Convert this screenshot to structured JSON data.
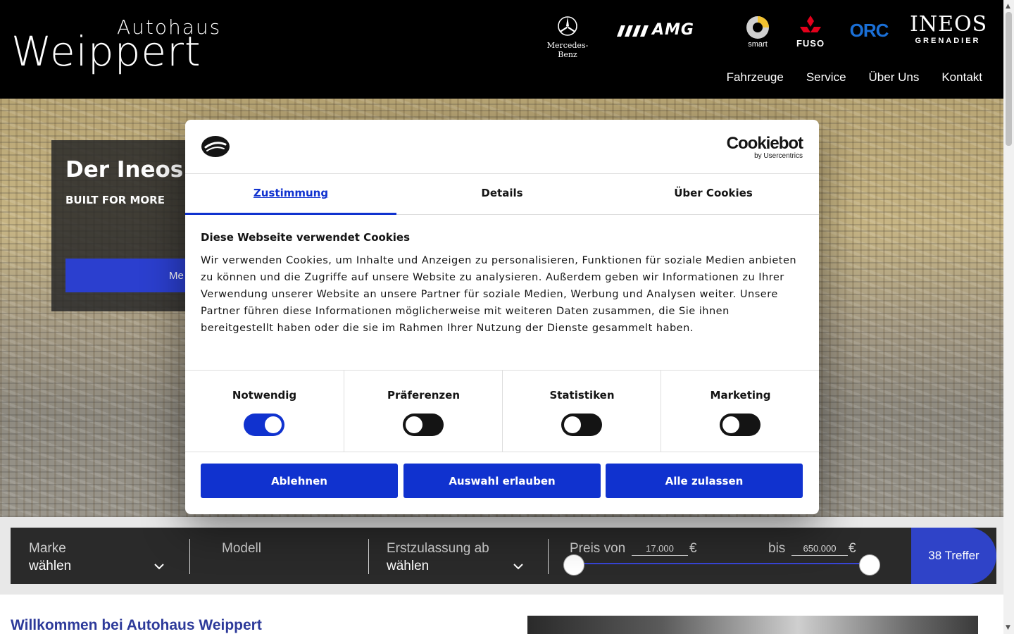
{
  "header": {
    "logo_top": "Autohaus",
    "logo_bottom": "Weippert",
    "brands": [
      "Mercedes-Benz",
      "AMG",
      "smart",
      "FUSO",
      "ORC",
      "INEOS",
      "GRENADIER"
    ],
    "nav": [
      "Fahrzeuge",
      "Service",
      "Über Uns",
      "Kontakt"
    ]
  },
  "hero": {
    "title": "Der Ineos G",
    "subtitle": "BUILT FOR MORE",
    "button": "Me"
  },
  "search": {
    "marke_label": "Marke",
    "marke_value": "wählen",
    "modell_label": "Modell",
    "ez_label": "Erstzulassung ab",
    "ez_value": "wählen",
    "preis_von_label": "Preis von",
    "preis_von": "17.000",
    "bis_label": "bis",
    "preis_bis": "650.000",
    "currency": "€",
    "treffer": "38 Treffer"
  },
  "welcome": "Willkommen bei Autohaus Weippert",
  "cookie": {
    "brand": "Cookiebot",
    "brand_by": "by Usercentrics",
    "tabs": [
      "Zustimmung",
      "Details",
      "Über Cookies"
    ],
    "active_tab": "Zustimmung",
    "heading": "Diese Webseite verwendet Cookies",
    "text": "Wir verwenden Cookies, um Inhalte und Anzeigen zu personalisieren, Funktionen für soziale Medien anbieten zu können und die Zugriffe auf unsere Website zu analysieren. Außerdem geben wir Informationen zu Ihrer Verwendung unserer Website an unsere Partner für soziale Medien, Werbung und Analysen weiter. Unsere Partner führen diese Informationen möglicherweise mit weiteren Daten zusammen, die Sie ihnen bereitgestellt haben oder die sie im Rahmen Ihrer Nutzung der Dienste gesammelt haben.",
    "toggles": [
      {
        "label": "Notwendig",
        "on": true
      },
      {
        "label": "Präferenzen",
        "on": false
      },
      {
        "label": "Statistiken",
        "on": false
      },
      {
        "label": "Marketing",
        "on": false
      }
    ],
    "buttons": [
      "Ablehnen",
      "Auswahl erlauben",
      "Alle zulassen"
    ]
  },
  "colors": {
    "accent": "#1032cf",
    "header_bg": "#000000",
    "search_bg": "#2a2a2a",
    "treffer_bg": "#2f43c8"
  }
}
